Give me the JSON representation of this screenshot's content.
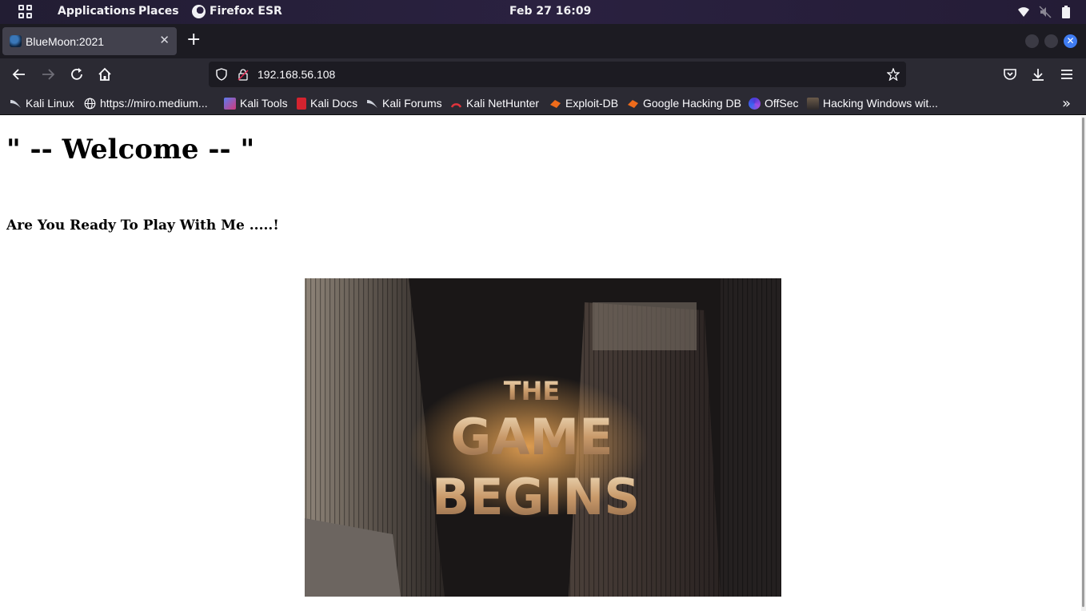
{
  "panel": {
    "applications": "Applications",
    "places": "Places",
    "browser": "Firefox ESR",
    "clock": "Feb 27  16:09"
  },
  "tab": {
    "title": "BlueMoon:2021"
  },
  "urlbar": {
    "url": "192.168.56.108"
  },
  "bookmarks": [
    {
      "label": "Kali Linux",
      "icon": "kali-dragon-icon"
    },
    {
      "label": "https://miro.medium...",
      "icon": "globe-icon"
    },
    {
      "label": "Kali Tools",
      "icon": "kali-tools-icon"
    },
    {
      "label": "Kali Docs",
      "icon": "kali-docs-icon"
    },
    {
      "label": "Kali Forums",
      "icon": "kali-forums-icon"
    },
    {
      "label": "Kali NetHunter",
      "icon": "nethunter-icon"
    },
    {
      "label": "Exploit-DB",
      "icon": "exploit-db-icon"
    },
    {
      "label": "Google Hacking DB",
      "icon": "ghdb-icon"
    },
    {
      "label": "OffSec",
      "icon": "offsec-icon"
    },
    {
      "label": "Hacking Windows wit...",
      "icon": "page-thumbnail-icon"
    }
  ],
  "page": {
    "heading": "\" -- Welcome -- \"",
    "subheading": "Are You Ready To Play With Me .....!",
    "banner": {
      "line1": "THE",
      "line2": "GAME",
      "line3": "BEGINS"
    }
  },
  "colors": {
    "panel_bg": "#221d33",
    "tab_strip_bg": "#1c1b22",
    "toolbar_bg": "#2b2a33",
    "active_tab_bg": "#42414d",
    "close_button_accent": "#3f7cf2"
  }
}
